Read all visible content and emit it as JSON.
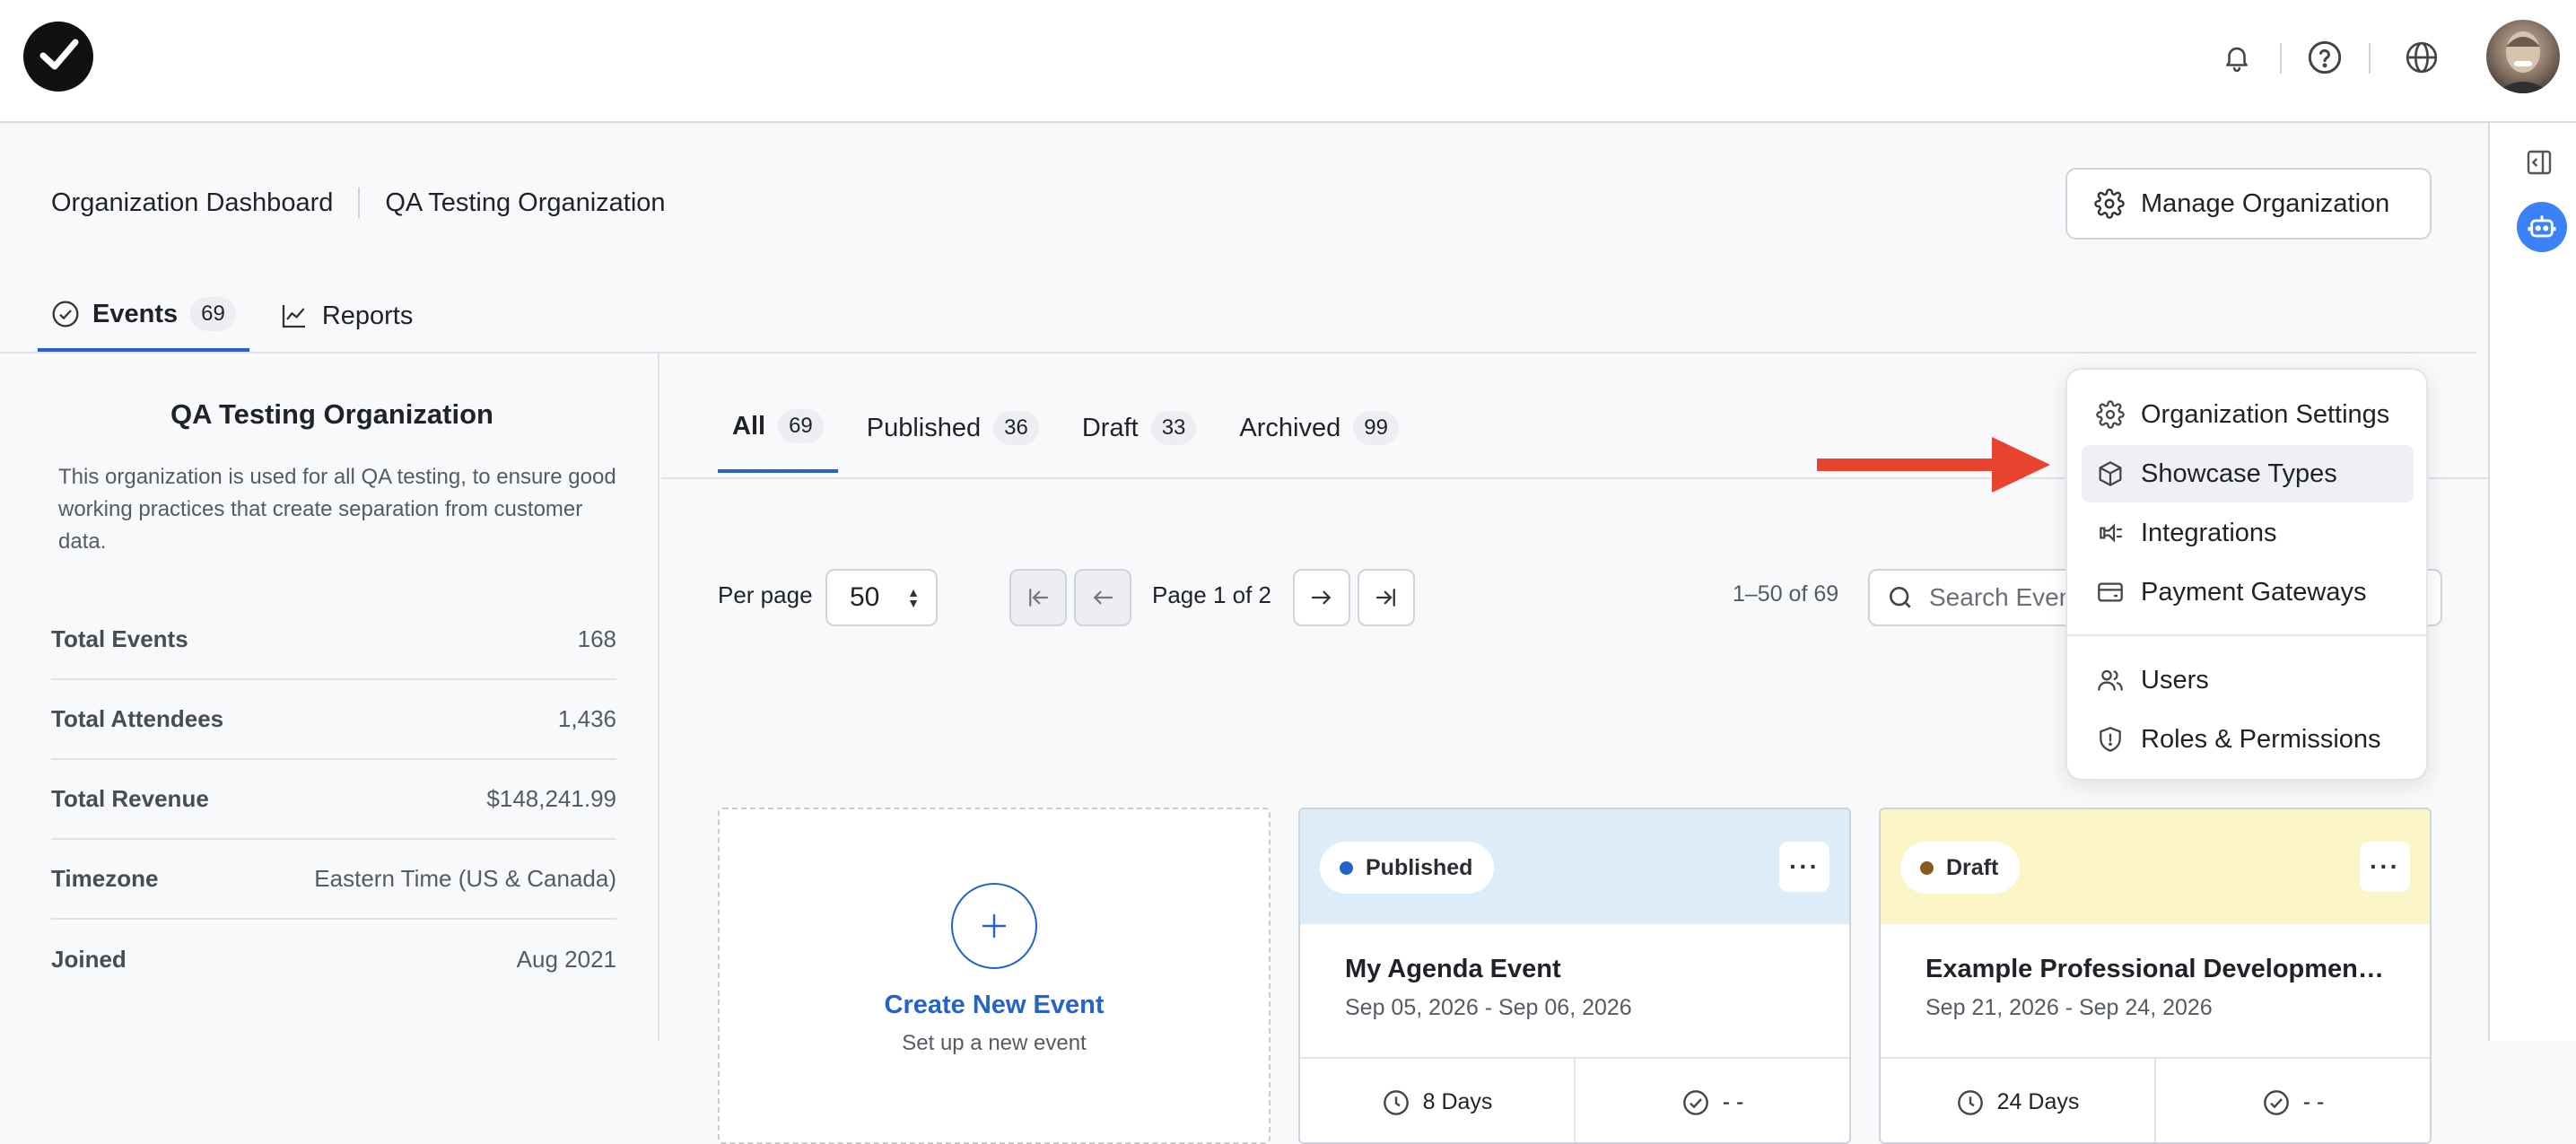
{
  "header": {
    "logo": "checkmark-logo",
    "icons": [
      "bell-icon",
      "help-icon",
      "globe-icon"
    ],
    "avatar": "user-avatar"
  },
  "breadcrumb": {
    "root": "Organization Dashboard",
    "current": "QA Testing Organization"
  },
  "manage_button": "Manage Organization",
  "tabs": [
    {
      "label": "Events",
      "count": "69",
      "icon": "check-circle-icon",
      "active": true
    },
    {
      "label": "Reports",
      "icon": "chart-line-icon",
      "active": false
    }
  ],
  "org": {
    "title": "QA Testing Organization",
    "description": "This organization is used for all QA testing, to ensure good working practices that create separation from customer data.",
    "stats": [
      {
        "label": "Total Events",
        "value": "168"
      },
      {
        "label": "Total Attendees",
        "value": "1,436"
      },
      {
        "label": "Total Revenue",
        "value": "$148,241.99"
      },
      {
        "label": "Timezone",
        "value": "Eastern Time (US & Canada)"
      },
      {
        "label": "Joined",
        "value": "Aug 2021"
      }
    ]
  },
  "subtabs": [
    {
      "label": "All",
      "count": "69",
      "active": true
    },
    {
      "label": "Published",
      "count": "36"
    },
    {
      "label": "Draft",
      "count": "33"
    },
    {
      "label": "Archived",
      "count": "99"
    }
  ],
  "pager": {
    "per_page_label": "Per page",
    "per_page_value": "50",
    "page_label": "Page 1 of 2",
    "range": "1–50 of 69",
    "search_placeholder": "Search Events"
  },
  "create_card": {
    "title": "Create New Event",
    "subtitle": "Set up a new event"
  },
  "events": [
    {
      "status": "Published",
      "status_color": "#2563c9",
      "header_bg": "#dcecf8",
      "title": "My Agenda Event",
      "dates": "Sep 05, 2026 - Sep 06, 2026",
      "duration": "8 Days",
      "check": "- -"
    },
    {
      "status": "Draft",
      "status_color": "#8a5a1e",
      "header_bg": "#fbf5c8",
      "title": "Example Professional Development ...",
      "dates": "Sep 21, 2026 - Sep 24, 2026",
      "duration": "24 Days",
      "check": "- -"
    }
  ],
  "dropdown": {
    "items": [
      {
        "label": "Organization Settings",
        "icon": "gear-icon"
      },
      {
        "label": "Showcase Types",
        "icon": "cube-icon",
        "highlighted": true
      },
      {
        "label": "Integrations",
        "icon": "plug-icon"
      },
      {
        "label": "Payment Gateways",
        "icon": "credit-card-icon"
      },
      {
        "label": "Users",
        "icon": "users-icon"
      },
      {
        "label": "Roles & Permissions",
        "icon": "shield-icon"
      }
    ]
  },
  "colors": {
    "accent": "#2563c9",
    "annotation_arrow": "#e8432e"
  }
}
